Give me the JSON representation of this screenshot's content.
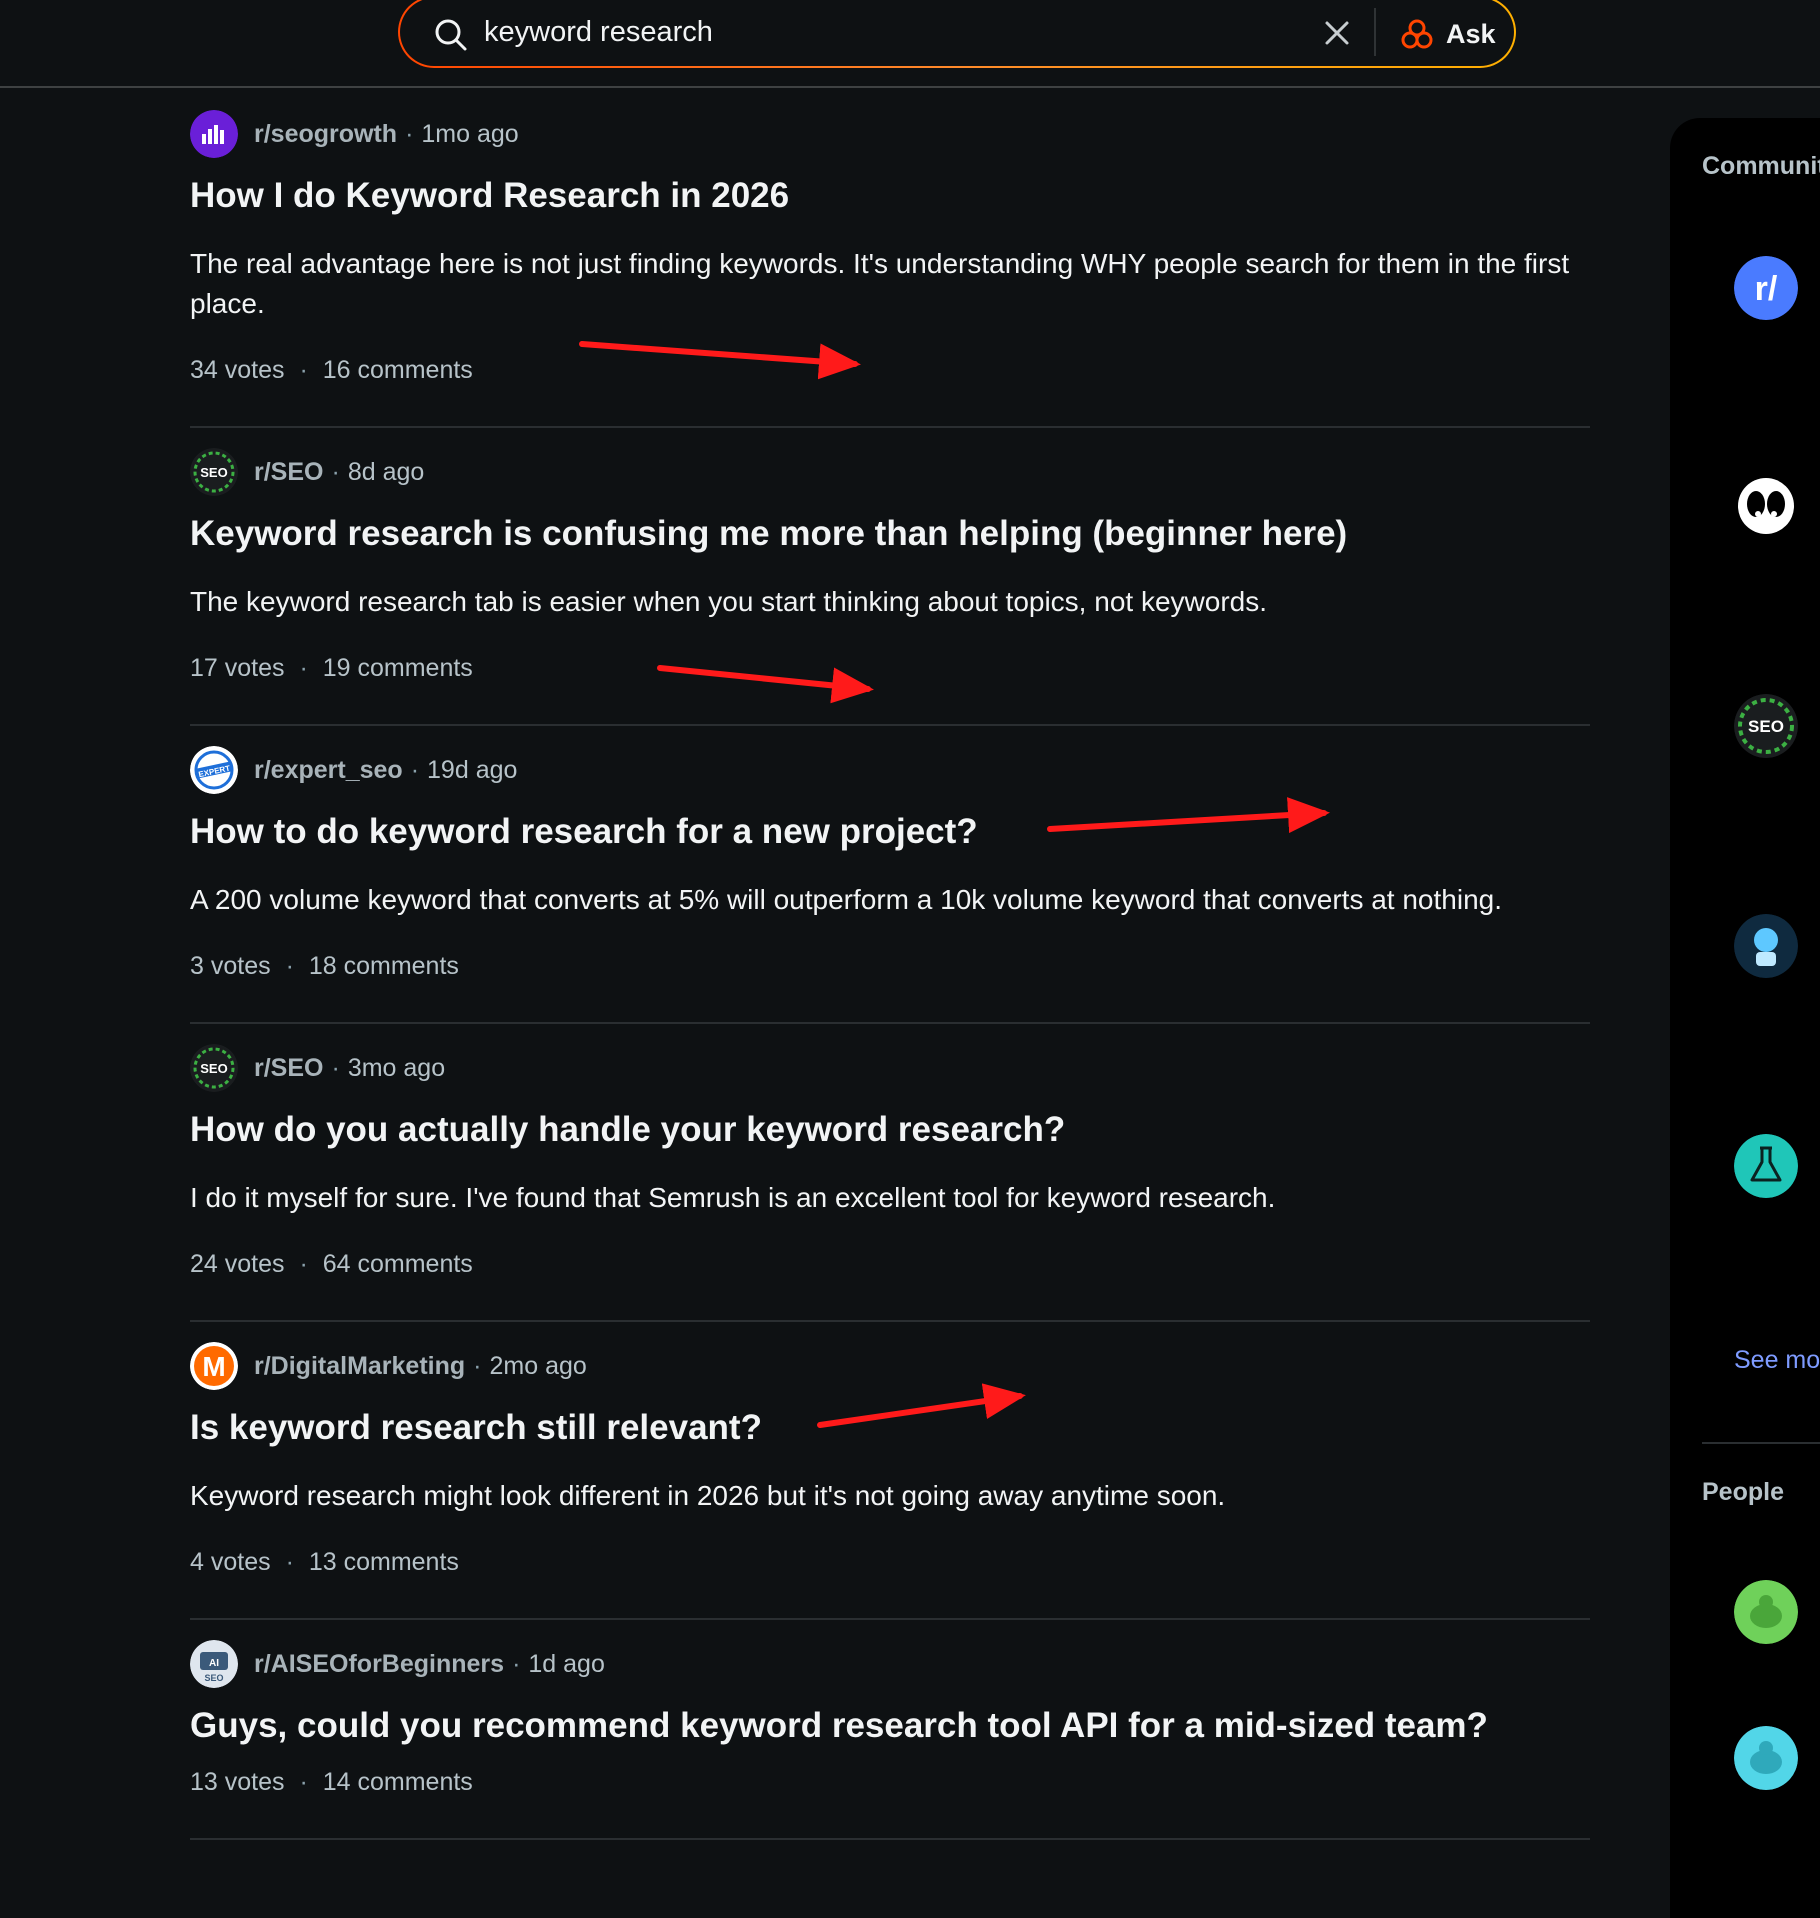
{
  "search": {
    "query": "keyword research",
    "clear_icon": "close-icon",
    "ask_label": "Ask",
    "ask_icon": "ask-logo-icon",
    "accent": "#ff4500"
  },
  "posts": [
    {
      "subreddit": "r/seogrowth",
      "time": "1mo ago",
      "title": "How I do Keyword Research in 2026",
      "body": "The real advantage here is not just finding keywords. It's understanding WHY people search for them in the first place.",
      "votes": "34 votes",
      "comments": "16 comments"
    },
    {
      "subreddit": "r/SEO",
      "time": "8d ago",
      "title": "Keyword research is confusing me more than helping (beginner here)",
      "body": "The keyword research tab is easier when you start thinking about topics, not keywords.",
      "votes": "17 votes",
      "comments": "19 comments"
    },
    {
      "subreddit": "r/expert_seo",
      "time": "19d ago",
      "title": "How to do keyword research for a new project?",
      "body": "A 200 volume keyword that converts at 5% will outperform a 10k volume keyword that converts at nothing.",
      "votes": "3 votes",
      "comments": "18 comments"
    },
    {
      "subreddit": "r/SEO",
      "time": "3mo ago",
      "title": "How do you actually handle your keyword research?",
      "body": "I do it myself for sure. I've found that Semrush is an excellent tool for keyword research.",
      "votes": "24 votes",
      "comments": "64 comments"
    },
    {
      "subreddit": "r/DigitalMarketing",
      "time": "2mo ago",
      "title": "Is keyword research still relevant?",
      "body": "Keyword research might look different in 2026 but it's not going away anytime soon.",
      "votes": "4 votes",
      "comments": "13 comments"
    },
    {
      "subreddit": "r/AISEOforBeginners",
      "time": "1d ago",
      "title": "Guys, could you recommend keyword research tool API for a mid-sized team?",
      "body": "",
      "votes": "13 votes",
      "comments": "14 comments"
    }
  ],
  "sidebar": {
    "communities_heading": "Communit",
    "see_more": "See mo",
    "people_heading": "People"
  },
  "colors": {
    "background": "#0e1113",
    "rail_background": "#000000",
    "annotation_arrow": "#ff1a1a",
    "link": "#7e9bff"
  }
}
